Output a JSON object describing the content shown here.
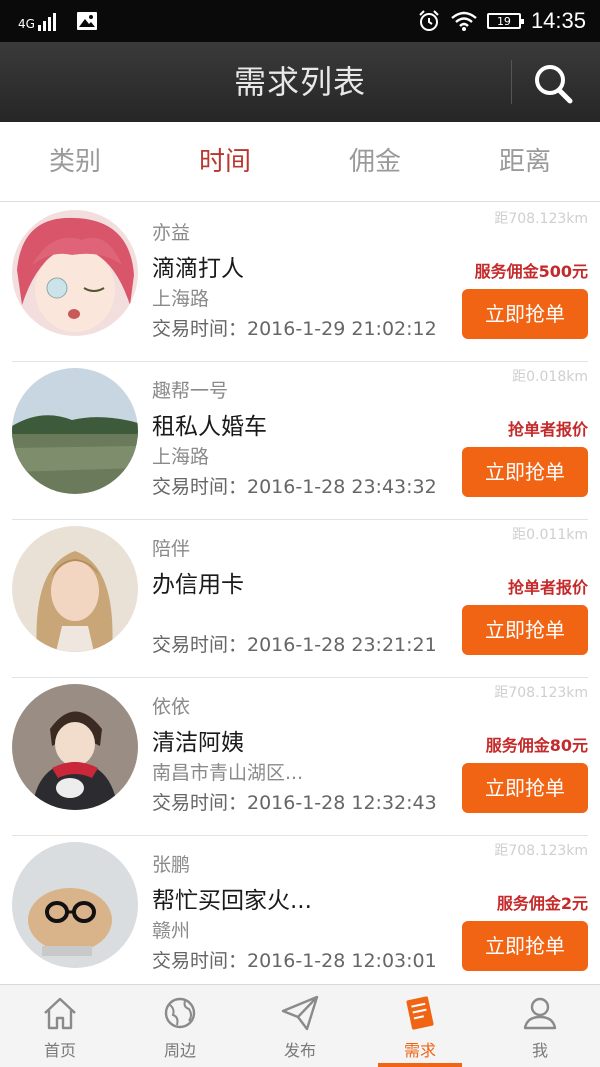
{
  "status_bar": {
    "network": "4G",
    "battery": "19",
    "time": "14:35"
  },
  "header": {
    "title": "需求列表"
  },
  "tabs": [
    {
      "label": "类别"
    },
    {
      "label": "时间",
      "active": true
    },
    {
      "label": "佣金"
    },
    {
      "label": "距离"
    }
  ],
  "items": [
    {
      "user": "亦益",
      "title": "滴滴打人",
      "location": "上海路",
      "time": "交易时间：2016-1-29 21:02:12",
      "distance": "距708.123km",
      "price": "服务佣金500元",
      "button": "立即抢单"
    },
    {
      "user": "趣帮一号",
      "title": "租私人婚车",
      "location": "上海路",
      "time": "交易时间：2016-1-28 23:43:32",
      "distance": "距0.018km",
      "price": "抢单者报价",
      "button": "立即抢单"
    },
    {
      "user": "陪伴",
      "title": "办信用卡",
      "location": "",
      "time": "交易时间：2016-1-28 23:21:21",
      "distance": "距0.011km",
      "price": "抢单者报价",
      "button": "立即抢单"
    },
    {
      "user": "依依",
      "title": "清洁阿姨",
      "location": "南昌市青山湖区...",
      "time": "交易时间：2016-1-28 12:32:43",
      "distance": "距708.123km",
      "price": "服务佣金80元",
      "button": "立即抢单"
    },
    {
      "user": "张鹏",
      "title": "帮忙买回家火...",
      "location": "赣州",
      "time": "交易时间：2016-1-28 12:03:01",
      "distance": "距708.123km",
      "price": "服务佣金2元",
      "button": "立即抢单"
    }
  ],
  "bottom_nav": [
    {
      "label": "首页",
      "icon": "home-icon"
    },
    {
      "label": "周边",
      "icon": "globe-icon"
    },
    {
      "label": "发布",
      "icon": "send-icon"
    },
    {
      "label": "需求",
      "icon": "document-icon",
      "active": true
    },
    {
      "label": "我",
      "icon": "user-icon"
    }
  ],
  "colors": {
    "accent": "#f06414",
    "price": "#c42a2a",
    "active_tab": "#b8372f",
    "header": "#2e2e2e"
  }
}
